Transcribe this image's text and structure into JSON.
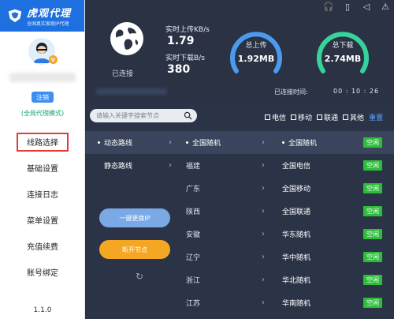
{
  "logo": {
    "title": "虎观代理",
    "subtitle": "全国真实家庭IP代理"
  },
  "user": {
    "logout": "注销",
    "mode": "(全局代理模式)"
  },
  "sidebar": {
    "items": [
      {
        "label": "线路选择"
      },
      {
        "label": "基础设置"
      },
      {
        "label": "连接日志"
      },
      {
        "label": "菜单设置"
      },
      {
        "label": "充值续费"
      },
      {
        "label": "账号绑定"
      }
    ],
    "version": "1.1.0"
  },
  "status": {
    "connected": "已连接",
    "upload_speed_label": "实时上传KB/s",
    "upload_speed": "1.79",
    "download_speed_label": "实时下载B/s",
    "download_speed": "380",
    "total_upload_label": "总上传",
    "total_upload": "1.92MB",
    "total_download_label": "总下载",
    "total_download": "2.74MB",
    "time_label": "已连接时间:",
    "time": "00 : 10 : 26"
  },
  "search": {
    "placeholder": "请输入关键字搜索节点"
  },
  "filters": {
    "items": [
      "电信",
      "移动",
      "联通",
      "其他"
    ],
    "reset": "重置"
  },
  "routes": [
    {
      "label": "动态路线"
    },
    {
      "label": "静态路线"
    }
  ],
  "provinces": [
    "全国随机",
    "福建",
    "广东",
    "陕西",
    "安徽",
    "辽宁",
    "浙江",
    "江苏"
  ],
  "nodes": [
    {
      "label": "全国随机",
      "status": "空闲"
    },
    {
      "label": "全国电信",
      "status": "空闲"
    },
    {
      "label": "全国移动",
      "status": "空闲"
    },
    {
      "label": "全国联通",
      "status": "空闲"
    },
    {
      "label": "华东随机",
      "status": "空闲"
    },
    {
      "label": "华中随机",
      "status": "空闲"
    },
    {
      "label": "华北随机",
      "status": "空闲"
    },
    {
      "label": "华南随机",
      "status": "空闲"
    }
  ],
  "actions": {
    "change_ip": "一键更换IP",
    "disconnect": "断开节点"
  },
  "colors": {
    "primary": "#1e6fe0",
    "dark": "#2b3446",
    "accent_blue": "#3d8ef0",
    "orange": "#f5a623",
    "green": "#2ebd3a",
    "gauge_blue": "#4a9bf0",
    "gauge_green": "#36d39a"
  },
  "icons": [
    "headset-icon",
    "phone-icon",
    "mute-icon",
    "warning-icon",
    "globe-icon",
    "search-icon",
    "refresh-icon"
  ]
}
